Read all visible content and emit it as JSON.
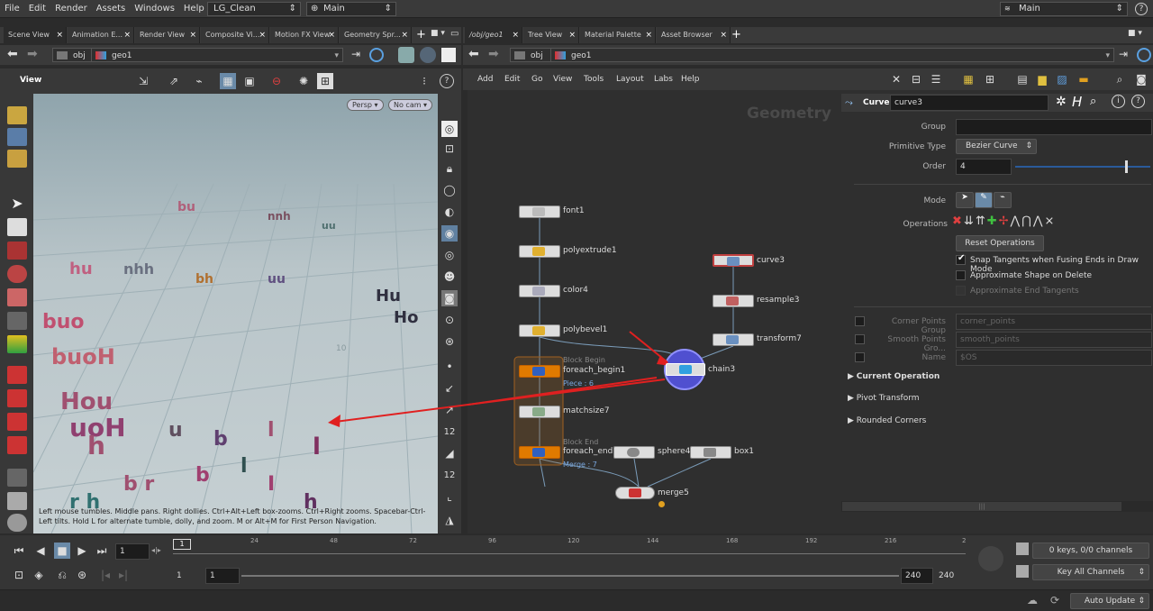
{
  "menu": {
    "items": [
      "File",
      "Edit",
      "Render",
      "Assets",
      "Windows",
      "Help"
    ],
    "desktop": "LG_Clean",
    "context": "Main",
    "right_context": "Main"
  },
  "left_tabs": [
    "Scene View",
    "Animation E...",
    "Render View",
    "Composite Vi...",
    "Motion FX View",
    "Geometry Spr..."
  ],
  "right_tabs": [
    "/obj/geo1",
    "Tree View",
    "Material Palette",
    "Asset Browser"
  ],
  "path": {
    "root": "obj",
    "node": "geo1"
  },
  "viewport": {
    "title": "View",
    "persp": "Persp ▾",
    "cam": "No cam ▾",
    "hint": "Left mouse tumbles. Middle pans. Right dollies. Ctrl+Alt+Left box-zooms. Ctrl+Right zooms. Spacebar-Ctrl-Left tilts. Hold L for alternate tumble, dolly, and zoom.     M or Alt+M for First Person Navigation.",
    "grid_label": "10"
  },
  "network": {
    "menu": [
      "Add",
      "Edit",
      "Go",
      "View",
      "Tools",
      "Layout",
      "Labs",
      "Help"
    ],
    "watermark": "Geometry",
    "nodes": {
      "font": "font1",
      "polyextrude": "polyextrude1",
      "color": "color4",
      "polybevel": "polybevel1",
      "foreach_begin": "foreach_begin1",
      "foreach_begin_tag": "Block Begin",
      "piece": "Piece : 6",
      "matchsize": "matchsize7",
      "foreach_end": "foreach_end1",
      "foreach_end_tag": "Block End",
      "merge_tag": "Merge : 7",
      "sphere": "sphere4",
      "box": "box1",
      "merge": "merge5",
      "curve": "curve3",
      "resample": "resample3",
      "transform": "transform7",
      "chain": "chain3"
    }
  },
  "params": {
    "type": "Curve",
    "name": "curve3",
    "group_label": "Group",
    "group": "",
    "prim_label": "Primitive Type",
    "prim": "Bezier Curve",
    "order_label": "Order",
    "order": "4",
    "order_level": 0.82,
    "mode_label": "Mode",
    "ops_label": "Operations",
    "reset": "Reset Operations",
    "snap": "Snap Tangents when Fusing Ends in Draw Mode",
    "approx_shape": "Approximate Shape on Delete",
    "approx_end": "Approximate End Tangents",
    "corner_label": "Corner Points Group",
    "corner": "corner_points",
    "smooth_label": "Smooth Points Gro...",
    "smooth": "smooth_points",
    "name_label": "Name",
    "name_val": "$OS",
    "sections": [
      "Current Operation",
      "Pivot Transform",
      "Rounded Corners"
    ]
  },
  "timeline": {
    "frame": "1",
    "ticks": [
      "24",
      "48",
      "72",
      "96",
      "120",
      "144",
      "168",
      "192",
      "216",
      "2"
    ],
    "start": "1",
    "start2": "1",
    "end": "240",
    "end2": "240",
    "keys": "0 keys, 0/0 channels",
    "keyall": "Key All Channels",
    "update": "Auto Update",
    "cur_marker": "1"
  },
  "colors": {
    "accent": "#e07a00",
    "red": "#e02020"
  }
}
